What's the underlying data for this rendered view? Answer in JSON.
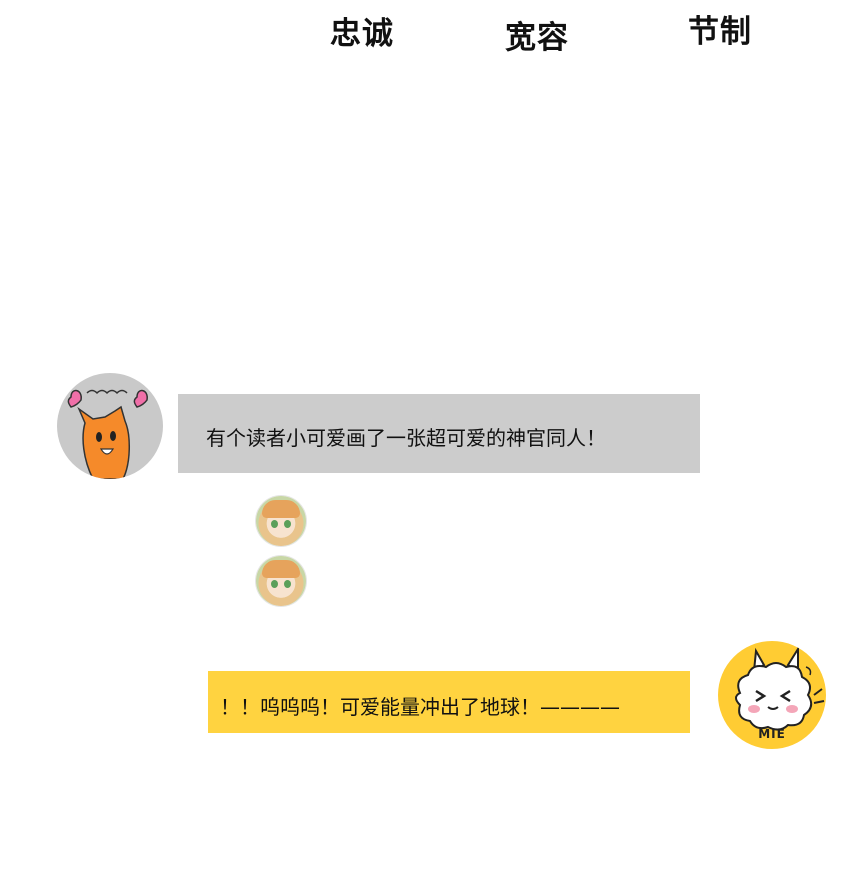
{
  "header": {
    "virtues": [
      "忠诚",
      "宽容",
      "节制"
    ]
  },
  "chat": {
    "left_message": "有个读者小可爱画了一张超可爱的神官同人！",
    "right_message": "！！呜呜呜！可爱能量冲出了地球！————",
    "right_avatar_text": "MIE"
  },
  "colors": {
    "gray_bubble": "#cccccc",
    "yellow_bubble": "#ffd340",
    "left_avatar_bg": "#c9c9c9",
    "right_avatar_bg": "#ffcc33",
    "orange_character": "#f58a2a",
    "heart": "#f06fa8"
  }
}
